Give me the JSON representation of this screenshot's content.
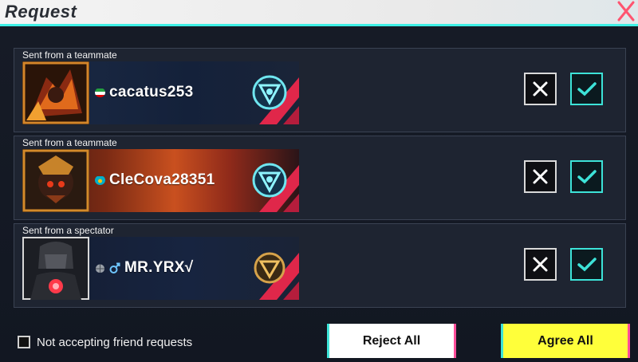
{
  "window": {
    "title": "Request"
  },
  "colors": {
    "accent": "#3de3d8",
    "agree": "#ffff3a",
    "reject": "#ffffff",
    "close": "#ff4e6a"
  },
  "requests": [
    {
      "label": "Sent from a teammate",
      "username": "cacatus253",
      "flag": "iran-flag-icon",
      "rank": "diamond-rank-icon"
    },
    {
      "label": "Sent from a teammate",
      "username": "CleCova28351",
      "flag": "kazakhstan-flag-icon",
      "rank": "diamond-rank-icon"
    },
    {
      "label": "Sent from a spectator",
      "username": "MR.YRX√",
      "flag": "globe-icon",
      "gender": "male-icon",
      "rank": "gold-rank-icon"
    }
  ],
  "footer": {
    "checkbox_label": "Not accepting friend requests",
    "checkbox_checked": false,
    "reject_label": "Reject All",
    "agree_label": "Agree All"
  }
}
